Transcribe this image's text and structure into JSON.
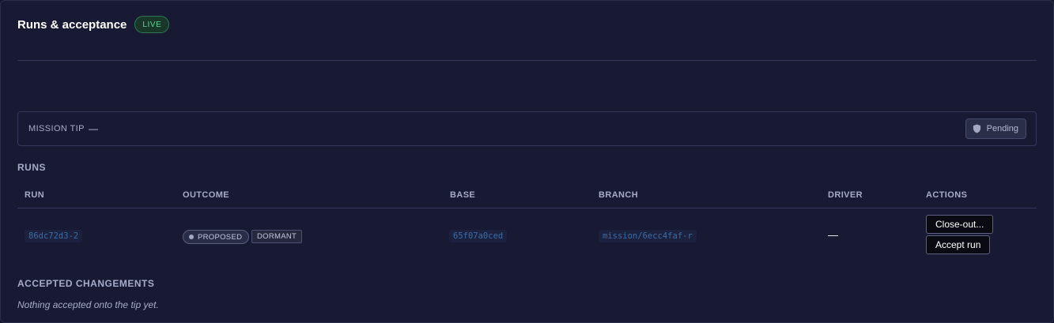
{
  "header": {
    "title": "Runs & acceptance",
    "status_badge": "LIVE"
  },
  "mission_tip": {
    "label": "MISSION TIP",
    "value": "—",
    "status_button": "Pending",
    "status_icon": "shield-icon"
  },
  "runs": {
    "section_title": "RUNS",
    "columns": [
      "RUN",
      "OUTCOME",
      "BASE",
      "BRANCH",
      "DRIVER",
      "ACTIONS"
    ],
    "rows": [
      {
        "run": "86dc72d3-2",
        "outcome": "PROPOSED",
        "state_tag": "DORMANT",
        "base": "65f07a0ced",
        "branch": "mission/6ecc4faf-r",
        "driver": "—",
        "actions": [
          "Close-out...",
          "Accept run"
        ]
      }
    ]
  },
  "accepted": {
    "section_title": "ACCEPTED CHANGEMENTS",
    "empty_text": "Nothing accepted onto the tip yet."
  },
  "colors": {
    "background": "#181a33",
    "live_green": "#5fd39a",
    "code_blue": "#3b6ea3"
  }
}
